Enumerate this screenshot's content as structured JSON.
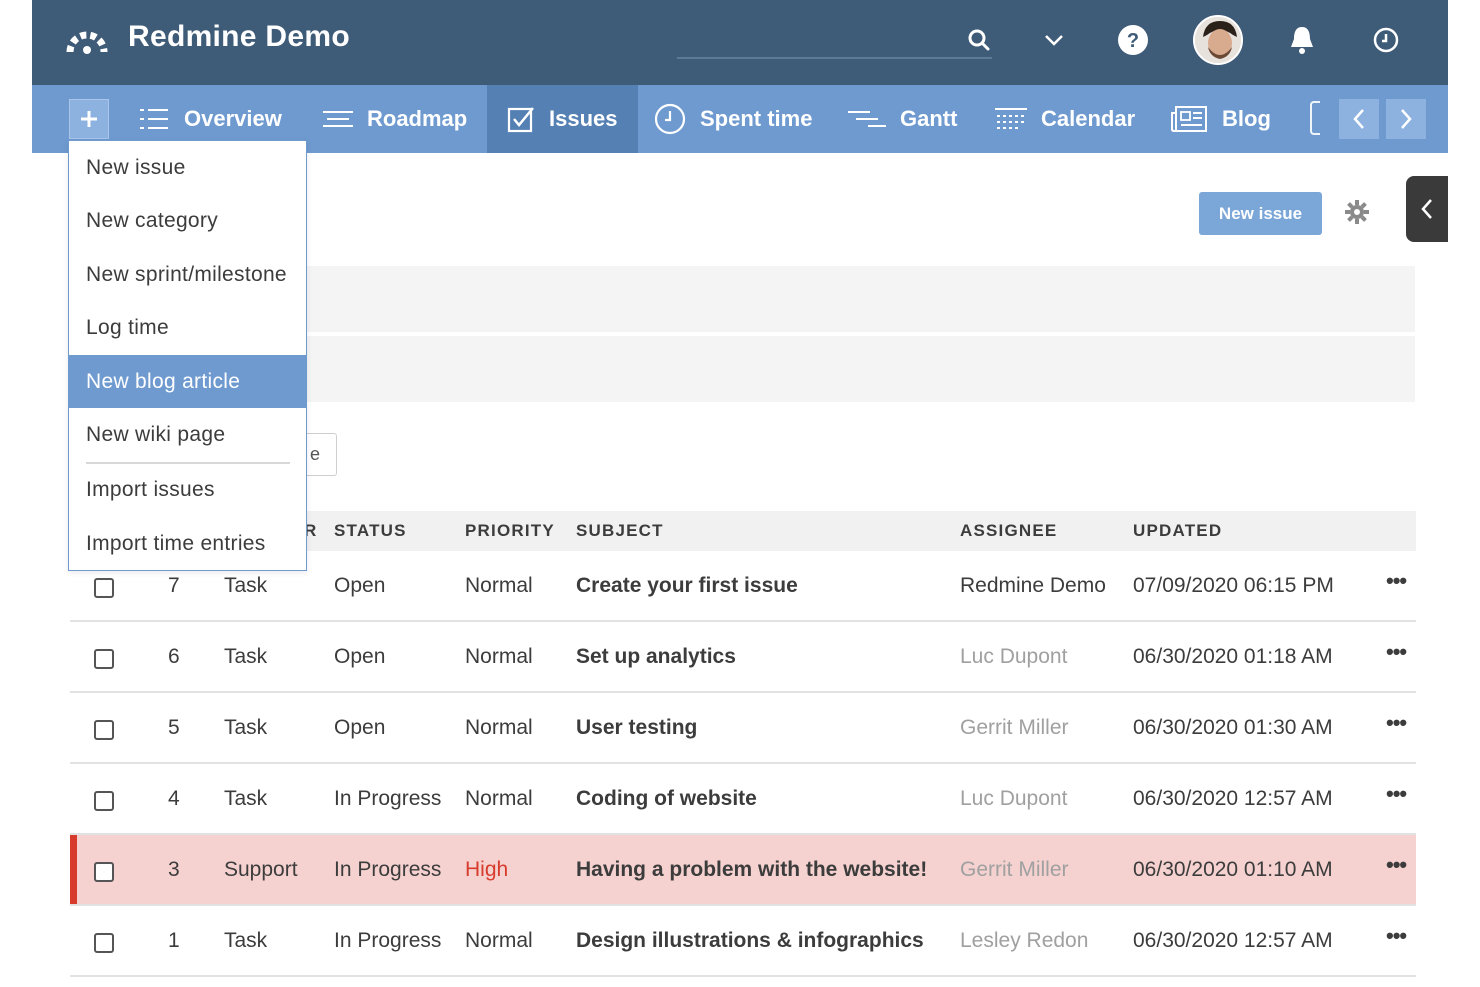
{
  "header": {
    "title": "Redmine Demo",
    "icons": [
      "logo-icon",
      "search-icon",
      "chevron-down-icon",
      "help-icon",
      "avatar",
      "bell-icon",
      "clock-icon"
    ]
  },
  "nav": {
    "items": [
      {
        "label": "Overview",
        "icon": "list-icon"
      },
      {
        "label": "Roadmap",
        "icon": "roadmap-icon"
      },
      {
        "label": "Issues",
        "icon": "checkbox-icon",
        "active": true
      },
      {
        "label": "Spent time",
        "icon": "clock-icon"
      },
      {
        "label": "Gantt",
        "icon": "gantt-icon"
      },
      {
        "label": "Calendar",
        "icon": "calendar-icon"
      },
      {
        "label": "Blog",
        "icon": "newspaper-icon"
      }
    ]
  },
  "toolbar": {
    "new_issue_label": "New issue",
    "apply_label_fragment": "e"
  },
  "dropdown": {
    "items": [
      "New issue",
      "New category",
      "New sprint/milestone",
      "Log time",
      "New blog article",
      "New wiki page",
      "Import issues",
      "Import time entries"
    ],
    "selected": "New blog article"
  },
  "table": {
    "columns": {
      "tracker_fragment": "R",
      "status": "STATUS",
      "priority": "PRIORITY",
      "subject": "SUBJECT",
      "assignee": "ASSIGNEE",
      "updated": "UPDATED"
    },
    "rows": [
      {
        "id": "7",
        "tracker": "Task",
        "status": "Open",
        "priority": "Normal",
        "subject": "Create your first issue",
        "assignee": "Redmine Demo",
        "updated": "07/09/2020 06:15 PM",
        "more": "•••"
      },
      {
        "id": "6",
        "tracker": "Task",
        "status": "Open",
        "priority": "Normal",
        "subject": "Set up analytics",
        "assignee": "Luc Dupont",
        "updated": "06/30/2020 01:18 AM",
        "more": "•••"
      },
      {
        "id": "5",
        "tracker": "Task",
        "status": "Open",
        "priority": "Normal",
        "subject": "User testing",
        "assignee": "Gerrit Miller",
        "updated": "06/30/2020 01:30 AM",
        "more": "•••"
      },
      {
        "id": "4",
        "tracker": "Task",
        "status": "In Progress",
        "priority": "Normal",
        "subject": "Coding of website",
        "assignee": "Luc Dupont",
        "updated": "06/30/2020 12:57 AM",
        "more": "•••"
      },
      {
        "id": "3",
        "tracker": "Support",
        "status": "In Progress",
        "priority": "High",
        "subject": "Having a problem with the website!",
        "assignee": "Gerrit Miller",
        "updated": "06/30/2020 01:10 AM",
        "more": "•••"
      },
      {
        "id": "1",
        "tracker": "Task",
        "status": "In Progress",
        "priority": "Normal",
        "subject": "Design illustrations & infographics",
        "assignee": "Lesley Redon",
        "updated": "06/30/2020 12:57 AM",
        "more": "•••"
      }
    ]
  },
  "colors": {
    "header_bg": "#3e5b78",
    "nav_bg": "#6e9ad0",
    "nav_active_bg": "#5580b4",
    "highlight_row_bg": "#f5d2d0",
    "priority_high": "#d73b2c"
  }
}
